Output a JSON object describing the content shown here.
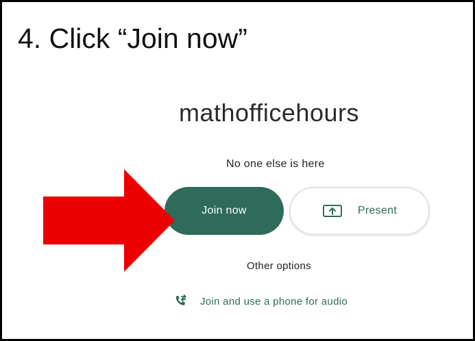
{
  "instruction": {
    "title": "4. Click “Join now”"
  },
  "meeting": {
    "name": "mathofficehours",
    "status": "No one else is here",
    "join_label": "Join now",
    "present_label": "Present",
    "other_options_label": "Other options",
    "phone_option_label": "Join and use a phone for audio"
  },
  "icons": {
    "present": "present-screen-icon",
    "phone": "phone-forward-icon",
    "arrow": "red-pointer-arrow"
  },
  "colors": {
    "accent": "#2f6b5a",
    "arrow": "#ee0000",
    "border": "#000000"
  }
}
